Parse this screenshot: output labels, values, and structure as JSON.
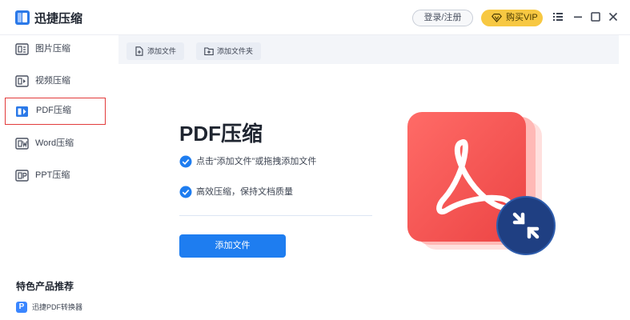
{
  "app": {
    "title": "迅捷压缩"
  },
  "header": {
    "login_label": "登录/注册",
    "vip_label": "购买VIP",
    "accent": "#2b79e8",
    "vip_color": "#f7c842"
  },
  "sidebar": {
    "items": [
      {
        "label": "图片压缩",
        "icon": "image-compress-icon"
      },
      {
        "label": "视频压缩",
        "icon": "video-compress-icon"
      },
      {
        "label": "PDF压缩",
        "icon": "pdf-compress-icon",
        "active": true
      },
      {
        "label": "Word压缩",
        "icon": "word-compress-icon"
      },
      {
        "label": "PPT压缩",
        "icon": "ppt-compress-icon"
      }
    ],
    "featured_title": "特色产品推荐",
    "featured_items": [
      {
        "label": "迅捷PDF转换器",
        "icon": "pdf-converter-icon",
        "icon_letter": "P"
      }
    ]
  },
  "toolbar": {
    "add_file_label": "添加文件",
    "add_folder_label": "添加文件夹"
  },
  "main": {
    "heading": "PDF压缩",
    "features": [
      "点击“添加文件”或拖拽添加文件",
      "高效压缩，保持文档质量"
    ],
    "primary_button": "添加文件",
    "primary_color": "#1e7df0",
    "hero_color": "#f0504f"
  }
}
